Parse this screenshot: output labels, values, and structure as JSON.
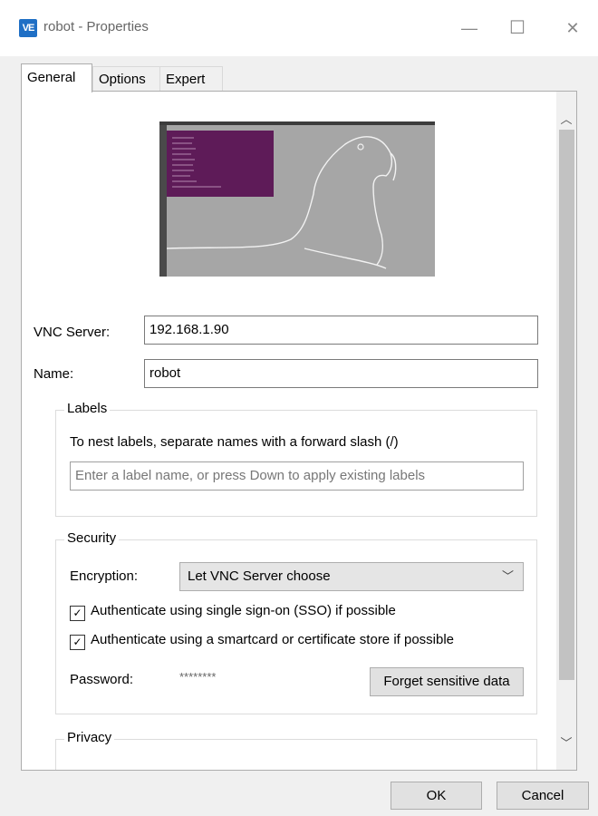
{
  "window": {
    "icon_text": "VE",
    "title": "robot - Properties",
    "minimize": "—",
    "maximize": "☐",
    "close": "✕"
  },
  "tabs": [
    {
      "label": "General",
      "active": true
    },
    {
      "label": "Options",
      "active": false
    },
    {
      "label": "Expert",
      "active": false
    }
  ],
  "general": {
    "vnc_server_label": "VNC Server:",
    "vnc_server_value": "192.168.1.90",
    "name_label": "Name:",
    "name_value": "robot"
  },
  "labels_group": {
    "title": "Labels",
    "hint": "To nest labels, separate names with a forward slash (/)",
    "input_placeholder": "Enter a label name, or press Down to apply existing labels"
  },
  "security_group": {
    "title": "Security",
    "encryption_label": "Encryption:",
    "encryption_value": "Let VNC Server choose",
    "sso_label": "Authenticate using single sign-on (SSO) if possible",
    "sso_checked": true,
    "smartcard_label": "Authenticate using a smartcard or certificate store if possible",
    "smartcard_checked": true,
    "password_label": "Password:",
    "password_value": "********",
    "forget_button": "Forget sensitive data"
  },
  "privacy_group": {
    "title": "Privacy"
  },
  "footer": {
    "ok": "OK",
    "cancel": "Cancel"
  },
  "colors": {
    "accent": "#1f6fc5",
    "terminal": "#5e1b58",
    "desktop": "#a6a6a6"
  }
}
